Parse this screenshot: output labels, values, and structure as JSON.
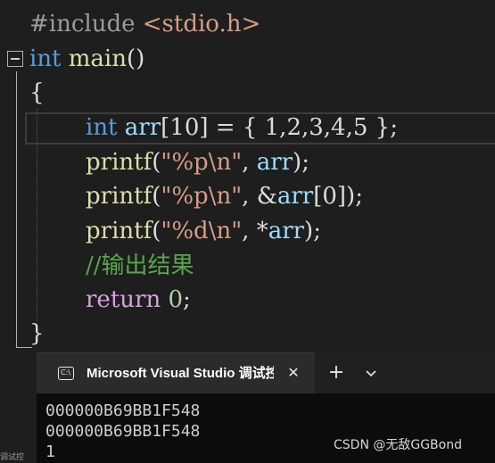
{
  "editor": {
    "lines": [
      {
        "include": "#include",
        "header": "<stdio.h>"
      },
      {
        "type": "int",
        "name": "main",
        "parens": "()"
      },
      {
        "brace": "{"
      },
      {
        "type": "int",
        "var": "arr",
        "bracket": "[10]",
        "rest": " = { 1,2,3,4,5 };"
      },
      {
        "fn": "printf",
        "open": "(",
        "str": "\"%p\\n\"",
        "sep": ", ",
        "arg": "arr",
        "close": ");"
      },
      {
        "fn": "printf",
        "open": "(",
        "str": "\"%p\\n\"",
        "sep": ", ",
        "amp": "&",
        "arg": "arr",
        "idx": "[0]",
        "close": ");"
      },
      {
        "fn": "printf",
        "open": "(",
        "str": "\"%d\\n\"",
        "sep": ", ",
        "star": "*",
        "arg": "arr",
        "close": ");"
      },
      {
        "comment": "//输出结果"
      },
      {
        "kw": "return",
        "val": "0",
        "end": ";"
      },
      {
        "brace": "}"
      }
    ]
  },
  "console": {
    "tab_title": "Microsoft Visual Studio 调试控制台",
    "tab_icon_text": "C:\\",
    "close_glyph": "✕",
    "new_tab_glyph": "+",
    "output": [
      "000000B69BB1F548",
      "000000B69BB1F548",
      "1"
    ]
  },
  "watermark": "CSDN @无敌GGBond",
  "left_strip_text": "调试控"
}
